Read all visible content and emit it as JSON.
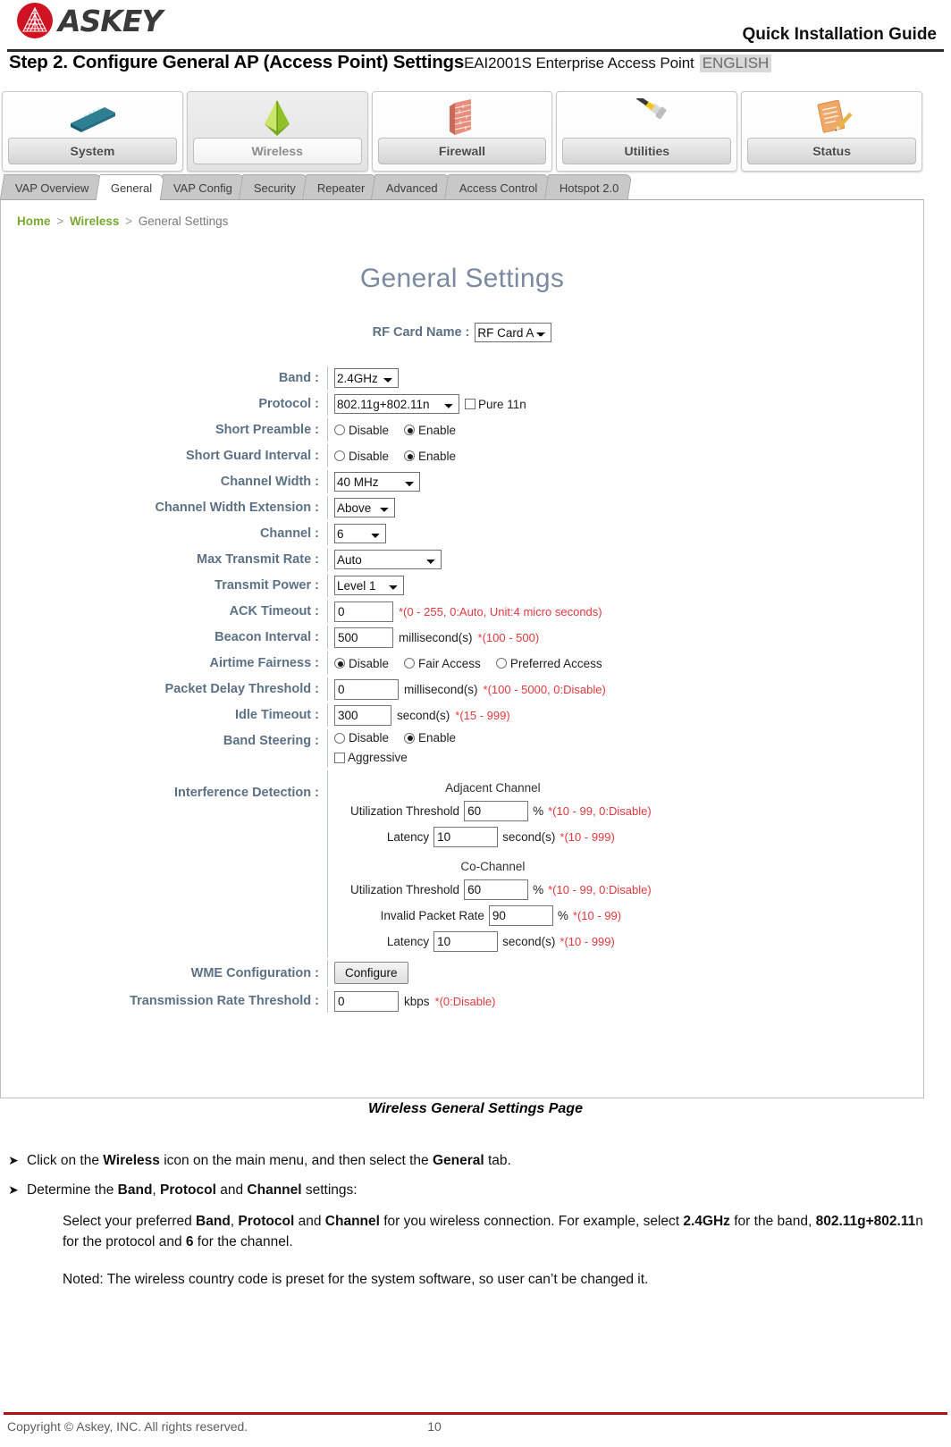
{
  "header": {
    "brand": "ASKEY",
    "guide_label": "Quick Installation Guide",
    "step_title": "Step 2. Configure General AP (Access Point) Settings",
    "model": "EAI2001S Enterprise Access Point",
    "language": "ENGLISH"
  },
  "main_menu": [
    {
      "label": "System",
      "icon": "router-device-icon"
    },
    {
      "label": "Wireless",
      "icon": "antenna-signal-icon"
    },
    {
      "label": "Firewall",
      "icon": "brick-wall-icon"
    },
    {
      "label": "Utilities",
      "icon": "hammer-icon"
    },
    {
      "label": "Status",
      "icon": "document-pencil-icon"
    }
  ],
  "tabs": [
    "VAP Overview",
    "General",
    "VAP Config",
    "Security",
    "Repeater",
    "Advanced",
    "Access Control",
    "Hotspot 2.0"
  ],
  "active_tab": "General",
  "breadcrumb": {
    "home": "Home",
    "section": "Wireless",
    "page": "General Settings",
    "separator": ">"
  },
  "page_title": "General Settings",
  "rf_card": {
    "label": "RF Card Name :",
    "value": "RF Card A"
  },
  "form": {
    "band": {
      "label": "Band :",
      "value": "2.4GHz"
    },
    "protocol": {
      "label": "Protocol :",
      "value": "802.11g+802.11n",
      "checkbox_label": "Pure 11n",
      "checkbox_checked": false
    },
    "short_preamble": {
      "label": "Short Preamble :",
      "off": "Disable",
      "on": "Enable",
      "selected": "Enable"
    },
    "short_guard": {
      "label": "Short Guard Interval :",
      "off": "Disable",
      "on": "Enable",
      "selected": "Enable"
    },
    "channel_width": {
      "label": "Channel Width :",
      "value": "40 MHz"
    },
    "channel_width_ext": {
      "label": "Channel Width Extension :",
      "value": "Above"
    },
    "channel": {
      "label": "Channel :",
      "value": "6"
    },
    "max_transmit_rate": {
      "label": "Max Transmit Rate :",
      "value": "Auto"
    },
    "transmit_power": {
      "label": "Transmit Power :",
      "value": "Level 1"
    },
    "ack_timeout": {
      "label": "ACK Timeout :",
      "value": "0",
      "hint": "*(0 - 255, 0:Auto, Unit:4 micro seconds)"
    },
    "beacon_interval": {
      "label": "Beacon Interval :",
      "value": "500",
      "unit": "millisecond(s)",
      "hint": "*(100 - 500)"
    },
    "airtime_fairness": {
      "label": "Airtime Fairness :",
      "opt1": "Disable",
      "opt2": "Fair Access",
      "opt3": "Preferred Access",
      "selected": "Disable"
    },
    "packet_delay": {
      "label": "Packet Delay Threshold :",
      "value": "0",
      "unit": "millisecond(s)",
      "hint": "*(100 - 5000, 0:Disable)"
    },
    "idle_timeout": {
      "label": "Idle Timeout :",
      "value": "300",
      "unit": "second(s)",
      "hint": "*(15 - 999)"
    },
    "band_steering": {
      "label": "Band Steering :",
      "off": "Disable",
      "on": "Enable",
      "selected": "Enable",
      "aggressive_label": "Aggressive",
      "aggressive_checked": false
    },
    "interference": {
      "label": "Interference Detection :",
      "adjacent_heading": "Adjacent Channel",
      "adjacent_util": {
        "key": "Utilization Threshold",
        "value": "60",
        "unit": "%",
        "hint": "*(10 - 99, 0:Disable)"
      },
      "adjacent_latency": {
        "key": "Latency",
        "value": "10",
        "unit": "second(s)",
        "hint": "*(10 - 999)"
      },
      "co_heading": "Co-Channel",
      "co_util": {
        "key": "Utilization Threshold",
        "value": "60",
        "unit": "%",
        "hint": "*(10 - 99, 0:Disable)"
      },
      "co_invalid": {
        "key": "Invalid Packet Rate",
        "value": "90",
        "unit": "%",
        "hint": "*(10 - 99)"
      },
      "co_latency": {
        "key": "Latency",
        "value": "10",
        "unit": "second(s)",
        "hint": "*(10 - 999)"
      }
    },
    "wme": {
      "label": "WME Configuration :",
      "button": "Configure"
    },
    "transmission_rate": {
      "label": "Transmission Rate Threshold :",
      "value": "0",
      "unit": "kbps",
      "hint": "*(0:Disable)"
    }
  },
  "caption": "Wireless General Settings Page",
  "instructions": {
    "bullet1": {
      "p1": "Click on the ",
      "b1": "Wireless",
      "p2": " icon on the main menu, and then select the ",
      "b2": "General",
      "p3": " tab."
    },
    "bullet2": {
      "p1": "Determine the ",
      "b1": "Band",
      "p2": ", ",
      "b2": "Protocol",
      "p3": " and ",
      "b3": "Channel",
      "p4": " settings:"
    },
    "paragraph": {
      "p1": "Select your preferred ",
      "b1": "Band",
      "p2": ", ",
      "b2": "Protocol",
      "p3": " and ",
      "b3": "Channel",
      "p4": " for you wireless connection. For example, select ",
      "b4": "2.4GHz",
      "p5": " for the band, ",
      "b5": "802.11g+802.11",
      "p6": "n for the protocol and ",
      "b6": "6",
      "p7": " for the channel."
    },
    "note": "Noted: The wireless country code is preset for the system software, so user can’t be changed it.",
    "arrow_glyph": "➤"
  },
  "footer": {
    "copyright": "Copyright © Askey, INC. All rights reserved.",
    "page_number": "10"
  },
  "colors": {
    "accent_red": "#b01116",
    "brand_red": "#cf1322",
    "label_blue": "#5d7185",
    "hint_red": "#e0393e",
    "link_green": "#7aa830"
  }
}
